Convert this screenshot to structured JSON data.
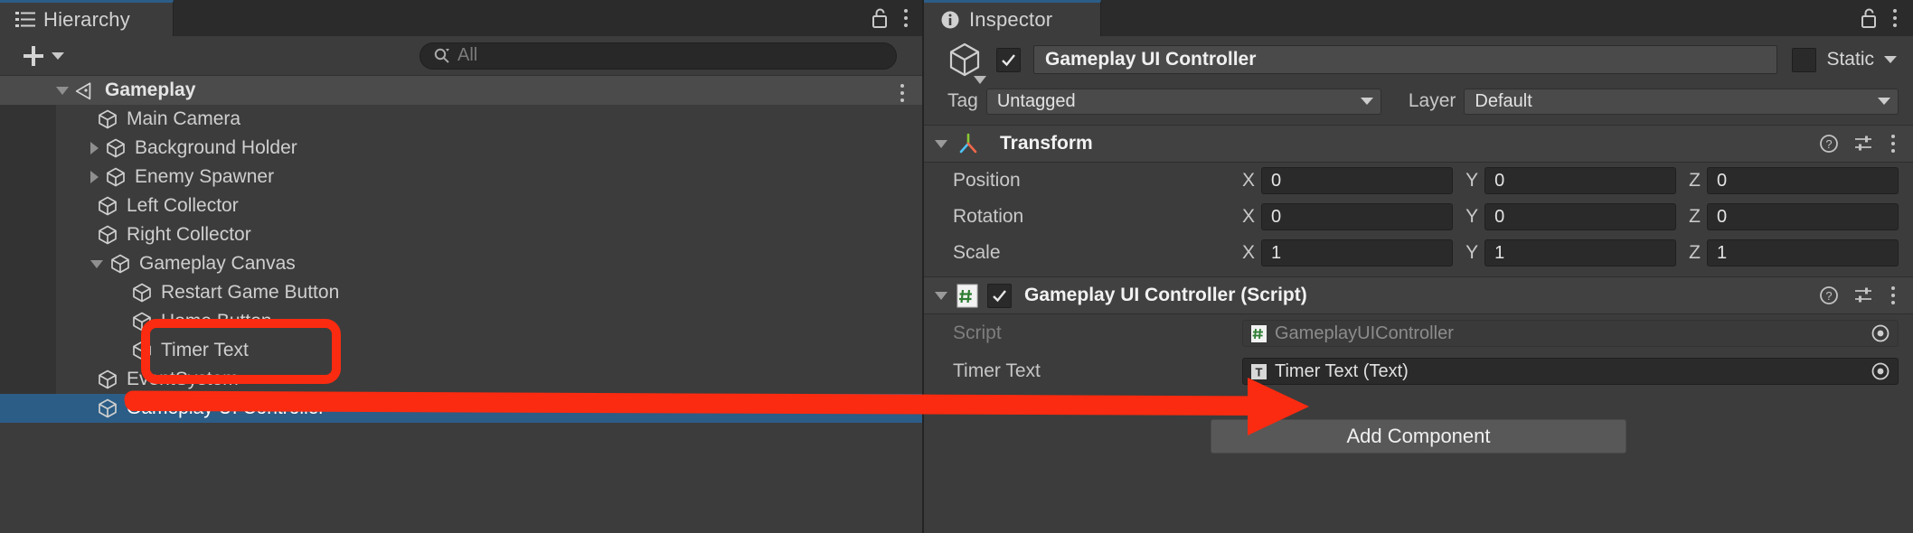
{
  "colors": {
    "panel_bg": "#3c3c3c",
    "tab_bg": "#2b2b2b",
    "tab_accent": "#2c5d87",
    "selection_blue": "#2b5d86",
    "annotation_red": "#fa2b10",
    "field_bg": "#2a2a2a",
    "component_header": "#414141"
  },
  "hierarchy": {
    "tab": {
      "label": "Hierarchy",
      "icon": "hierarchy-list-icon"
    },
    "lock_icon": "lock-open-icon",
    "menu_icon": "kebab-menu-icon",
    "toolbar": {
      "add_icon": "plus-icon",
      "add_dropdown_icon": "chevron-down-icon",
      "search_icon": "search-icon",
      "search_placeholder": "All",
      "search_value": ""
    },
    "items": [
      {
        "label": "Gameplay",
        "depth": 0,
        "twisty": "open",
        "icon": "unity-scene-icon",
        "kind": "scene",
        "selected": false,
        "has_menu": true
      },
      {
        "label": "Main Camera",
        "depth": 1,
        "twisty": "none",
        "icon": "gameobject-icon",
        "kind": "object",
        "selected": false,
        "has_menu": false
      },
      {
        "label": "Background Holder",
        "depth": 1,
        "twisty": "closed",
        "icon": "gameobject-icon",
        "kind": "object",
        "selected": false,
        "has_menu": false
      },
      {
        "label": "Enemy Spawner",
        "depth": 1,
        "twisty": "closed",
        "icon": "gameobject-icon",
        "kind": "object",
        "selected": false,
        "has_menu": false
      },
      {
        "label": "Left Collector",
        "depth": 1,
        "twisty": "none",
        "icon": "gameobject-icon",
        "kind": "object",
        "selected": false,
        "has_menu": false
      },
      {
        "label": "Right Collector",
        "depth": 1,
        "twisty": "none",
        "icon": "gameobject-icon",
        "kind": "object",
        "selected": false,
        "has_menu": false
      },
      {
        "label": "Gameplay Canvas",
        "depth": 1,
        "twisty": "open",
        "icon": "gameobject-icon",
        "kind": "object",
        "selected": false,
        "has_menu": false
      },
      {
        "label": "Restart Game Button",
        "depth": 2,
        "twisty": "none",
        "icon": "gameobject-icon",
        "kind": "object",
        "selected": false,
        "has_menu": false
      },
      {
        "label": "Home Button",
        "depth": 2,
        "twisty": "none",
        "icon": "gameobject-icon",
        "kind": "object",
        "selected": false,
        "has_menu": false
      },
      {
        "label": "Timer Text",
        "depth": 2,
        "twisty": "none",
        "icon": "gameobject-icon",
        "kind": "object",
        "selected": false,
        "has_menu": false
      },
      {
        "label": "EventSystem",
        "depth": 1,
        "twisty": "none",
        "icon": "gameobject-icon",
        "kind": "object",
        "selected": false,
        "has_menu": false
      },
      {
        "label": "Gameplay UI Controller",
        "depth": 1,
        "twisty": "none",
        "icon": "gameobject-icon",
        "kind": "object",
        "selected": true,
        "has_menu": false
      }
    ]
  },
  "inspector": {
    "tab": {
      "label": "Inspector",
      "icon": "info-circle-icon"
    },
    "lock_icon": "lock-open-icon",
    "menu_icon": "kebab-menu-icon",
    "header": {
      "prefab_icon": "prefab-cube-icon",
      "enabled": true,
      "name": "Gameplay UI Controller",
      "static_label": "Static",
      "static_checked": false,
      "static_dropdown_icon": "chevron-down-icon"
    },
    "tag_row": {
      "tag_label": "Tag",
      "tag_value": "Untagged",
      "layer_label": "Layer",
      "layer_value": "Default"
    },
    "components": [
      {
        "title": "Transform",
        "icon": "transform-axis-icon",
        "has_checkbox": false,
        "help_icon": "help-circle-icon",
        "preset_icon": "preset-sliders-icon",
        "menu_icon": "kebab-menu-icon",
        "vectors": [
          {
            "label": "Position",
            "x": "0",
            "y": "0",
            "z": "0"
          },
          {
            "label": "Rotation",
            "x": "0",
            "y": "0",
            "z": "0"
          },
          {
            "label": "Scale",
            "x": "1",
            "y": "1",
            "z": "1"
          }
        ],
        "axis_labels": {
          "x": "X",
          "y": "Y",
          "z": "Z"
        }
      },
      {
        "title": "Gameplay UI Controller (Script)",
        "icon": "csharp-script-icon",
        "has_checkbox": true,
        "enabled": true,
        "help_icon": "help-circle-icon",
        "preset_icon": "preset-sliders-icon",
        "menu_icon": "kebab-menu-icon",
        "properties": [
          {
            "label": "Script",
            "value": "GameplayUIController",
            "value_icon": "csharp-script-icon",
            "disabled": true,
            "picker_icon": "object-picker-icon"
          },
          {
            "label": "Timer Text",
            "value": "Timer Text (Text)",
            "value_icon": "text-component-icon",
            "disabled": false,
            "picker_icon": "object-picker-icon"
          }
        ]
      }
    ],
    "add_component_label": "Add Component"
  },
  "annotations": {
    "highlight_box": {
      "target": "Timer Text",
      "shape": "rounded-rectangle",
      "color": "#fa2b10"
    },
    "arrow": {
      "from": "hierarchy Timer Text",
      "to": "inspector Timer Text field",
      "color": "#fa2b10"
    }
  }
}
